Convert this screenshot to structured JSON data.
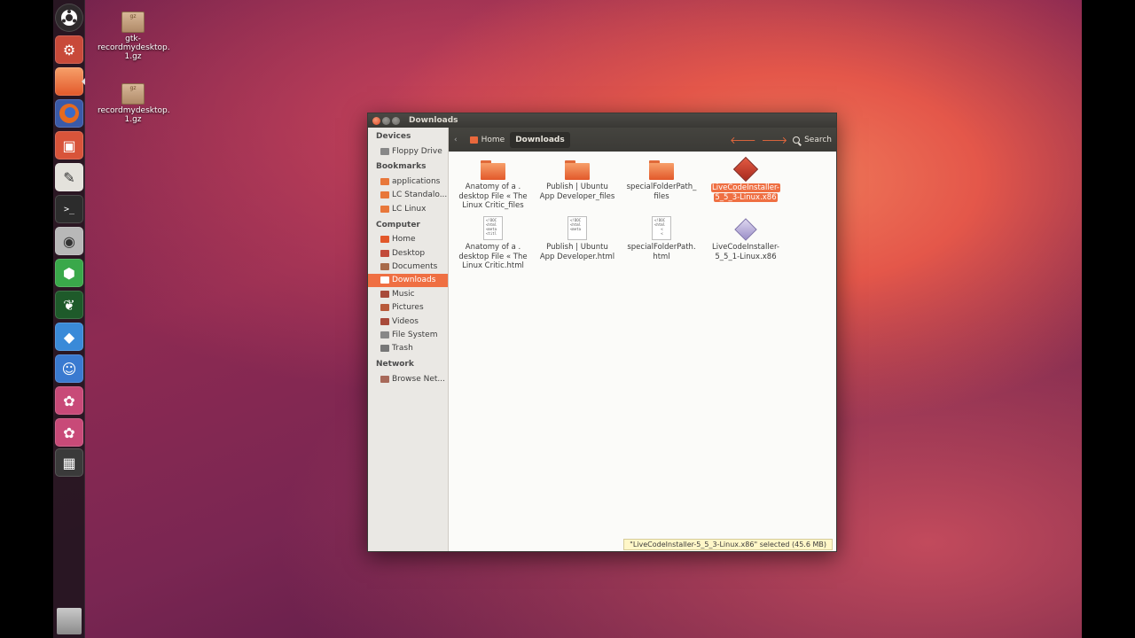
{
  "window": {
    "title": "Downloads"
  },
  "desktop_icons": [
    {
      "label": "gtk-recordmydesktop.1.gz",
      "lines": [
        "gtk-",
        "recordmydesktop.",
        "1.gz"
      ],
      "box_text": "gz"
    },
    {
      "label": "recordmydesktop.1.gz",
      "lines": [
        "recordmydesktop.",
        "1.gz"
      ],
      "box_text": "gz"
    }
  ],
  "sidebar": {
    "devices_header": "Devices",
    "devices": [
      {
        "label": "Floppy Drive",
        "icon": "floppy-icon"
      }
    ],
    "bookmarks_header": "Bookmarks",
    "bookmarks": [
      {
        "label": "applications",
        "icon": "folder-icon"
      },
      {
        "label": "LC Standalo...",
        "icon": "folder-icon"
      },
      {
        "label": "LC Linux",
        "icon": "folder-icon"
      }
    ],
    "computer_header": "Computer",
    "computer": [
      {
        "label": "Home",
        "icon": "home-icon"
      },
      {
        "label": "Desktop",
        "icon": "desktop-icon"
      },
      {
        "label": "Documents",
        "icon": "documents-icon"
      },
      {
        "label": "Downloads",
        "icon": "downloads-icon",
        "active": true
      },
      {
        "label": "Music",
        "icon": "music-icon"
      },
      {
        "label": "Pictures",
        "icon": "pictures-icon"
      },
      {
        "label": "Videos",
        "icon": "videos-icon"
      },
      {
        "label": "File System",
        "icon": "drive-icon"
      },
      {
        "label": "Trash",
        "icon": "trash-icon"
      }
    ],
    "network_header": "Network",
    "network": [
      {
        "label": "Browse Net...",
        "icon": "network-icon"
      }
    ]
  },
  "toolbar": {
    "crumb_home": "Home",
    "crumb_current": "Downloads",
    "search_label": "Search"
  },
  "files": [
    {
      "name": "Anatomy of a . desktop File « The Linux Critic_files",
      "lines": [
        "Anatomy of a .",
        "desktop File « The",
        "Linux Critic_files"
      ],
      "type": "folder"
    },
    {
      "name": "Publish | Ubuntu App Developer_files",
      "lines": [
        "Publish | Ubuntu",
        "App Developer_files"
      ],
      "type": "folder"
    },
    {
      "name": "specialFolderPath_files",
      "lines": [
        "specialFolderPath_",
        "files"
      ],
      "type": "folder"
    },
    {
      "name": "LiveCodeInstaller-5_5_3-Linux.x86",
      "lines": [
        "LiveCodeInstaller-",
        "5_5_3-Linux.x86"
      ],
      "type": "installer",
      "selected": true
    },
    {
      "name": "Anatomy of a . desktop File « The Linux Critic.html",
      "lines": [
        "Anatomy of a .",
        "desktop File « The",
        "Linux Critic.html"
      ],
      "type": "html",
      "preview": "<!DOC\n<html\n<meta\n<titl"
    },
    {
      "name": "Publish | Ubuntu App Developer.html",
      "lines": [
        "Publish | Ubuntu",
        "App Developer.html"
      ],
      "type": "html",
      "preview": "<!DOC\n<html\n<meta"
    },
    {
      "name": "specialFolderPath.html",
      "lines": [
        "specialFolderPath.",
        "html"
      ],
      "type": "html",
      "preview": "<!DOC\n<html\n<\n<"
    },
    {
      "name": "LiveCodeInstaller-5_5_1-Linux.x86",
      "lines": [
        "LiveCodeInstaller-",
        "5_5_1-Linux.x86"
      ],
      "type": "installer-alt"
    }
  ],
  "status": "\"LiveCodeInstaller-5_5_3-Linux.x86\" selected (45.6 MB)",
  "launcher": [
    {
      "name": "dash-home-icon",
      "color": "#3a3a3a"
    },
    {
      "name": "software-updater-icon",
      "color": "#c84a3a"
    },
    {
      "name": "home-folder-icon",
      "color": "#e8773a"
    },
    {
      "name": "firefox-icon",
      "color": "#e56a1f"
    },
    {
      "name": "ubuntu-software-center-icon",
      "color": "#d8543a"
    },
    {
      "name": "text-editor-icon",
      "color": "#8a8a8a"
    },
    {
      "name": "terminal-icon",
      "color": "#2c2c2c"
    },
    {
      "name": "screenshot-icon",
      "color": "#7a7a7a"
    },
    {
      "name": "green-cube-app-icon",
      "color": "#3aa84a"
    },
    {
      "name": "green-leaf-app-icon",
      "color": "#2a7a3a"
    },
    {
      "name": "blue-box-app-icon",
      "color": "#3a8ad8"
    },
    {
      "name": "blue-robot-app-icon",
      "color": "#3a7ad0"
    },
    {
      "name": "pink-app-icon",
      "color": "#c84a78"
    },
    {
      "name": "pink-app-2-icon",
      "color": "#c84a78"
    },
    {
      "name": "workspace-switcher-icon",
      "color": "#3a3a3a"
    }
  ],
  "colors": {
    "accent": "#ef6f42",
    "titlebar": "#3c3b37",
    "status_bg": "#fff7c8"
  }
}
